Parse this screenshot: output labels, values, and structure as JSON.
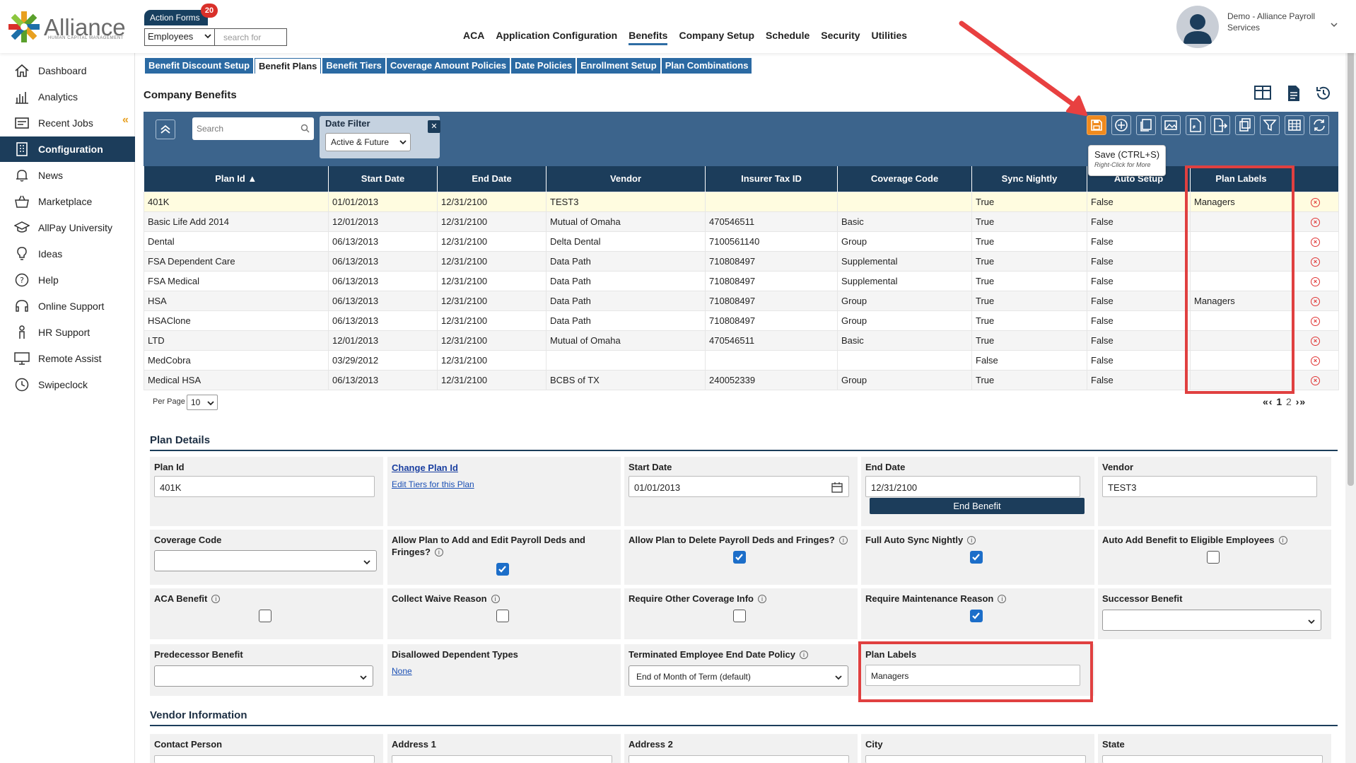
{
  "logo": {
    "word": "Alliance",
    "sub": "HUMAN CAPITAL MANAGEMENT"
  },
  "header": {
    "action_forms": "Action Forms",
    "action_forms_badge": "20",
    "employee_select": "Employees",
    "search_placeholder": "search for",
    "nav": [
      "ACA",
      "Application Configuration",
      "Benefits",
      "Company Setup",
      "Schedule",
      "Security",
      "Utilities"
    ],
    "user_name": "Demo - Alliance Payroll Services"
  },
  "sidebar": {
    "items": [
      {
        "label": "Dashboard",
        "icon": "home-icon"
      },
      {
        "label": "Analytics",
        "icon": "analytics-icon"
      },
      {
        "label": "Recent Jobs",
        "icon": "recent-jobs-icon"
      },
      {
        "label": "Configuration",
        "icon": "building-icon"
      },
      {
        "label": "News",
        "icon": "bell-icon"
      },
      {
        "label": "Marketplace",
        "icon": "basket-icon"
      },
      {
        "label": "AllPay University",
        "icon": "graduation-icon"
      },
      {
        "label": "Ideas",
        "icon": "lightbulb-icon"
      },
      {
        "label": "Help",
        "icon": "question-icon"
      },
      {
        "label": "Online Support",
        "icon": "headset-icon"
      },
      {
        "label": "HR Support",
        "icon": "person-icon"
      },
      {
        "label": "Remote Assist",
        "icon": "monitor-icon"
      },
      {
        "label": "Swipeclock",
        "icon": "clock-icon"
      }
    ]
  },
  "tabs": [
    "Benefit Discount Setup",
    "Benefit Plans",
    "Benefit Tiers",
    "Coverage Amount Policies",
    "Date Policies",
    "Enrollment Setup",
    "Plan Combinations"
  ],
  "page_title": "Company Benefits",
  "toolbar": {
    "search_placeholder": "Search",
    "date_filter_title": "Date Filter",
    "date_filter_value": "Active & Future",
    "tooltip_main": "Save (CTRL+S)",
    "tooltip_sub": "Right-Click for More"
  },
  "grid": {
    "columns": [
      "Plan Id ▲",
      "Start Date",
      "End Date",
      "Vendor",
      "Insurer Tax ID",
      "Coverage Code",
      "Sync Nightly",
      "Auto Setup",
      "Plan Labels"
    ],
    "rows": [
      [
        "401K",
        "01/01/2013",
        "12/31/2100",
        "TEST3",
        "",
        "",
        "True",
        "False",
        "Managers"
      ],
      [
        "Basic Life Add 2014",
        "12/01/2013",
        "12/31/2100",
        "Mutual of Omaha",
        "470546511",
        "Basic",
        "True",
        "False",
        ""
      ],
      [
        "Dental",
        "06/13/2013",
        "12/31/2100",
        "Delta Dental",
        "7100561140",
        "Group",
        "True",
        "False",
        ""
      ],
      [
        "FSA Dependent Care",
        "06/13/2013",
        "12/31/2100",
        "Data Path",
        "710808497",
        "Supplemental",
        "True",
        "False",
        ""
      ],
      [
        "FSA Medical",
        "06/13/2013",
        "12/31/2100",
        "Data Path",
        "710808497",
        "Supplemental",
        "True",
        "False",
        ""
      ],
      [
        "HSA",
        "06/13/2013",
        "12/31/2100",
        "Data Path",
        "710808497",
        "Group",
        "True",
        "False",
        "Managers"
      ],
      [
        "HSAClone",
        "06/13/2013",
        "12/31/2100",
        "Data Path",
        "710808497",
        "Group",
        "True",
        "False",
        ""
      ],
      [
        "LTD",
        "12/01/2013",
        "12/31/2100",
        "Mutual of Omaha",
        "470546511",
        "Basic",
        "True",
        "False",
        ""
      ],
      [
        "MedCobra",
        "03/29/2012",
        "12/31/2100",
        "",
        "",
        "",
        "False",
        "False",
        ""
      ],
      [
        "Medical HSA",
        "06/13/2013",
        "12/31/2100",
        "BCBS of TX",
        "240052339",
        "Group",
        "True",
        "False",
        ""
      ]
    ],
    "per_page_label": "Per Page",
    "per_page": "10",
    "pages": [
      "1",
      "2"
    ]
  },
  "plan_details": {
    "section": "Plan Details",
    "plan_id_label": "Plan Id",
    "plan_id": "401K",
    "change_plan_id": "Change Plan Id",
    "edit_tiers": "Edit Tiers for this Plan",
    "start_date_label": "Start Date",
    "start_date": "01/01/2013",
    "end_date_label": "End Date",
    "end_date": "12/31/2100",
    "end_benefit": "End Benefit",
    "vendor_label": "Vendor",
    "vendor": "TEST3",
    "coverage_code_label": "Coverage Code",
    "allow_add_edit_label": "Allow Plan to Add and Edit Payroll Deds and Fringes?",
    "allow_delete_label": "Allow Plan to Delete Payroll Deds and Fringes?",
    "full_auto_sync_label": "Full Auto Sync Nightly",
    "auto_add_label": "Auto Add Benefit to Eligible Employees",
    "aca_benefit_label": "ACA Benefit",
    "collect_waive_label": "Collect Waive Reason",
    "require_other_label": "Require Other Coverage Info",
    "require_maint_label": "Require Maintenance Reason",
    "successor_label": "Successor Benefit",
    "predecessor_label": "Predecessor Benefit",
    "disallowed_label": "Disallowed Dependent Types",
    "disallowed_value": "None",
    "term_policy_label": "Terminated Employee End Date Policy",
    "term_policy_value": "End of Month of Term (default)",
    "plan_labels_label": "Plan Labels",
    "plan_labels_value": "Managers",
    "checks": {
      "allow_add_edit": true,
      "allow_delete": true,
      "full_auto_sync": true,
      "auto_add": false,
      "aca_benefit": false,
      "collect_waive": false,
      "require_other": false,
      "require_maint": true
    }
  },
  "vendor_info": {
    "section": "Vendor Information",
    "labels": [
      "Contact Person",
      "Address 1",
      "Address 2",
      "City",
      "State"
    ]
  },
  "colors": {
    "navy": "#1c3d5b",
    "toolbar": "#3c648c",
    "tab": "#2b6aa3",
    "save": "#f08a1d",
    "highlight": "#e04040",
    "link": "#1a4fb4"
  }
}
